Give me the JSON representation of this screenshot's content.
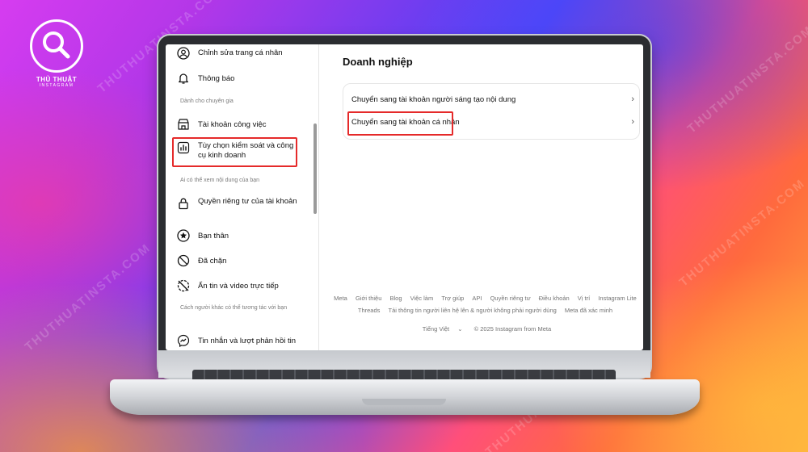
{
  "brand": {
    "logo_title": "THỦ THUẬT",
    "logo_subtitle": "INSTAGRAM",
    "watermark": "THUTHUATINSTA.COM"
  },
  "colors": {
    "highlight": "#e52a2a",
    "screen_bg": "#ffffff"
  },
  "sidebar": {
    "items": [
      {
        "label": "Chỉnh sửa trang cá nhân",
        "icon": "user-circle-icon"
      },
      {
        "label": "Thông báo",
        "icon": "bell-icon"
      },
      {
        "label": "Tài khoản công việc",
        "icon": "shop-icon"
      },
      {
        "label": "Tùy chọn kiểm soát và công cụ kinh doanh",
        "icon": "bar-chart-icon"
      },
      {
        "label": "Quyền riêng tư của tài khoản",
        "icon": "lock-icon"
      },
      {
        "label": "Bạn thân",
        "icon": "star-icon"
      },
      {
        "label": "Đã chặn",
        "icon": "block-icon"
      },
      {
        "label": "Ẩn tin và video trực tiếp",
        "icon": "hide-story-icon"
      },
      {
        "label": "Tin nhắn và lượt phản hồi tin",
        "icon": "messenger-icon"
      }
    ],
    "sections": [
      "Dành cho chuyên gia",
      "Ai có thể xem nội dung của bạn",
      "Cách người khác có thể tương tác với bạn"
    ]
  },
  "main": {
    "heading": "Doanh nghiệp",
    "options": [
      {
        "label": "Chuyển sang tài khoản người sáng tạo nội dung"
      },
      {
        "label": "Chuyển sang tài khoản cá nhân"
      }
    ],
    "chevron": "›"
  },
  "footer": {
    "links_row1": [
      "Meta",
      "Giới thiệu",
      "Blog",
      "Việc làm",
      "Trợ giúp",
      "API",
      "Quyền riêng tư",
      "Điều khoản",
      "Vị trí",
      "Instagram Lite"
    ],
    "links_row2": [
      "Threads",
      "Tải thông tin người liên hệ lên & người không phải người dùng",
      "Meta đã xác minh"
    ],
    "language": "Tiếng Việt",
    "copyright": "© 2025 Instagram from Meta"
  }
}
